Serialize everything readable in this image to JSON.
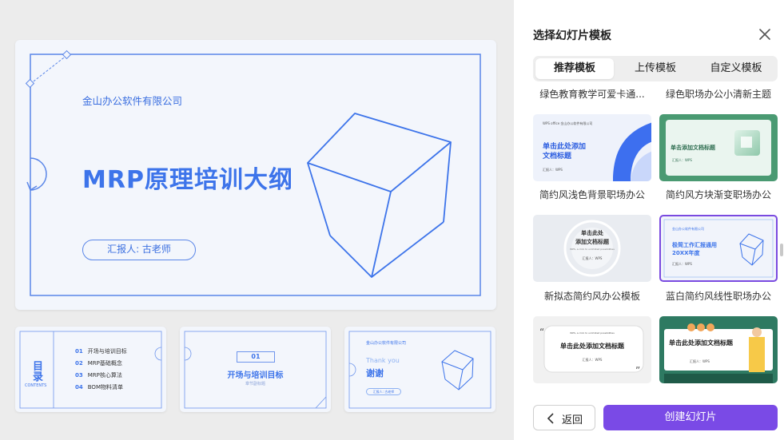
{
  "main_slide": {
    "company": "金山办公软件有限公司",
    "title": "MRP原理培训大纲",
    "reporter": "汇报人: 古老师"
  },
  "thumbnails": {
    "toc": {
      "title_big": "目录",
      "title_en": "CONTENTS",
      "items": [
        {
          "num": "01",
          "label": "开场与培训目标"
        },
        {
          "num": "02",
          "label": "MRP基础概念"
        },
        {
          "num": "03",
          "label": "MRP核心算法"
        },
        {
          "num": "04",
          "label": "BOM物料清单"
        }
      ]
    },
    "section": {
      "num": "01",
      "title": "开场与培训目标",
      "subtitle": "章节副标题"
    },
    "end": {
      "company": "金山办公软件有限公司",
      "en": "Thank you",
      "cn": "谢谢",
      "reporter": "汇报人: 古老师"
    }
  },
  "panel": {
    "title": "选择幻灯片模板",
    "tabs": [
      {
        "label": "推荐模板",
        "active": true
      },
      {
        "label": "上传模板",
        "active": false
      },
      {
        "label": "自定义模板",
        "active": false
      }
    ],
    "templates": [
      {
        "name": "绿色教育教学可爱卡通...",
        "thumb": null
      },
      {
        "name": "绿色职场办公小清新主题",
        "thumb": null
      },
      {
        "name": "简约风浅色背景职场办公",
        "thumb": {
          "top": "WPS office 金山办公软件有限公司",
          "line1": "单击此处添加",
          "line2": "文档标题",
          "rep": "汇报人：WPS"
        }
      },
      {
        "name": "简约风方块渐变职场办公",
        "thumb": {
          "title": "单击添加文档标题",
          "rep": "汇报人：WPS"
        }
      },
      {
        "name": "新拟态简约风办公模板",
        "thumb": {
          "line1": "单击此处",
          "line2": "添加文档标题",
          "en": "WPS, a click to unlimited possibilities",
          "rep": "汇报人：WPS"
        }
      },
      {
        "name": "蓝白简约风线性职场办公",
        "thumb": {
          "top": "金山办公软件有限公司",
          "line1": "极简工作汇报通用",
          "line2": "20XX年度",
          "rep": "汇报人：WPS"
        },
        "selected": true
      },
      {
        "name": "",
        "thumb": {
          "en": "WPS, a click to unlimited possibilities",
          "title": "单击此处添加文档标题",
          "rep": "汇报人：WPS"
        }
      },
      {
        "name": "",
        "thumb": {
          "title": "单击此处添加文档标题",
          "rep": "汇报人：WPS"
        }
      }
    ],
    "back_label": "返回",
    "create_label": "创建幻灯片",
    "colors": {
      "accent": "#7a4ae6",
      "slide_blue": "#3d74ea"
    }
  }
}
